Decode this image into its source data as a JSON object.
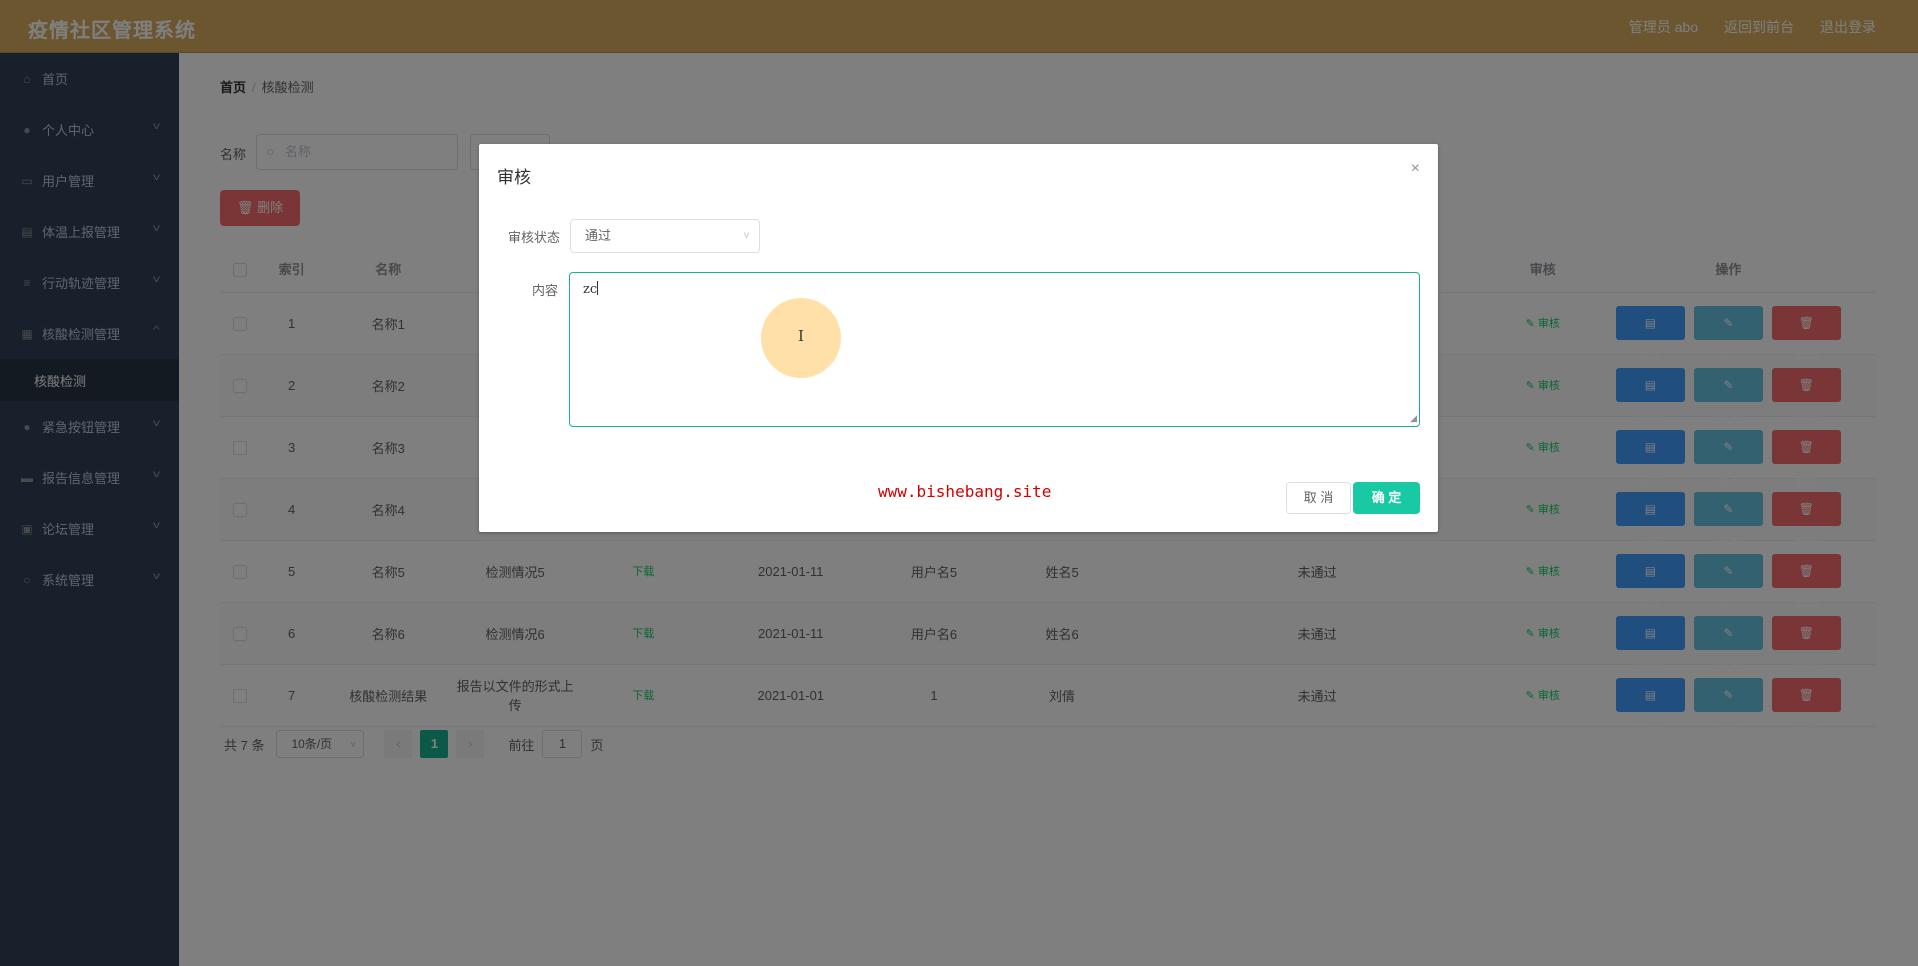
{
  "header": {
    "app_title": "疫情社区管理系统",
    "user": "管理员 abo",
    "to_front": "返回到前台",
    "logout": "退出登录"
  },
  "sidebar": {
    "items": [
      {
        "label": "首页",
        "icon": "home-icon"
      },
      {
        "label": "个人中心",
        "icon": "user-icon"
      },
      {
        "label": "用户管理",
        "icon": "users-icon"
      },
      {
        "label": "体温上报管理",
        "icon": "report-icon"
      },
      {
        "label": "行动轨迹管理",
        "icon": "list-icon"
      },
      {
        "label": "核酸检测管理",
        "icon": "grid-icon"
      },
      {
        "label": "核酸检测",
        "icon": ""
      },
      {
        "label": "紧急按钮管理",
        "icon": "user-icon"
      },
      {
        "label": "报告信息管理",
        "icon": "chat-icon"
      },
      {
        "label": "论坛管理",
        "icon": "forum-icon"
      },
      {
        "label": "系统管理",
        "icon": "system-icon"
      }
    ]
  },
  "breadcrumb": {
    "home": "首页",
    "current": "核酸检测"
  },
  "filter": {
    "label": "名称",
    "placeholder": "名称"
  },
  "toolbar": {
    "delete": "删除"
  },
  "table": {
    "headers": {
      "index": "索引",
      "name": "名称",
      "audit": "审核",
      "ops": "操作"
    },
    "rows": [
      {
        "index": "1",
        "name": "名称1",
        "detail": "",
        "file": "",
        "date": "",
        "username": "",
        "realname": "",
        "status": ""
      },
      {
        "index": "2",
        "name": "名称2",
        "detail": "",
        "file": "",
        "date": "",
        "username": "",
        "realname": "",
        "status": ""
      },
      {
        "index": "3",
        "name": "名称3",
        "detail": "",
        "file": "",
        "date": "",
        "username": "",
        "realname": "",
        "status": ""
      },
      {
        "index": "4",
        "name": "名称4",
        "detail": "",
        "file": "",
        "date": "",
        "username": "",
        "realname": "",
        "status": ""
      },
      {
        "index": "5",
        "name": "名称5",
        "detail": "检测情况5",
        "file": "下载",
        "date": "2021-01-11",
        "username": "用户名5",
        "realname": "姓名5",
        "status": "未通过"
      },
      {
        "index": "6",
        "name": "名称6",
        "detail": "检测情况6",
        "file": "下载",
        "date": "2021-01-11",
        "username": "用户名6",
        "realname": "姓名6",
        "status": "未通过"
      },
      {
        "index": "7",
        "name": "核酸检测结果",
        "detail": "报告以文件的形式上传",
        "file": "下载",
        "date": "2021-01-01",
        "username": "1",
        "realname": "刘倩",
        "status": "未通过"
      }
    ],
    "audit_link": "审核",
    "btn_detail": "详情",
    "btn_edit": "修改",
    "btn_delete": "删除"
  },
  "pagination": {
    "total": "共 7 条",
    "page_size": "10条/页",
    "current": "1",
    "goto": "前往",
    "goto_value": "1",
    "page_unit": "页"
  },
  "dialog": {
    "title": "审核",
    "status_label": "审核状态",
    "status_value": "通过",
    "content_label": "内容",
    "content_value": "zc",
    "watermark": "www.bishebang.site",
    "cancel": "取 消",
    "confirm": "确 定"
  },
  "colors": {
    "header_bg": "#d6ad5f",
    "sidebar_bg": "#304156",
    "primary": "#19c9a4",
    "danger": "#f56c6c",
    "info": "#409eff"
  }
}
